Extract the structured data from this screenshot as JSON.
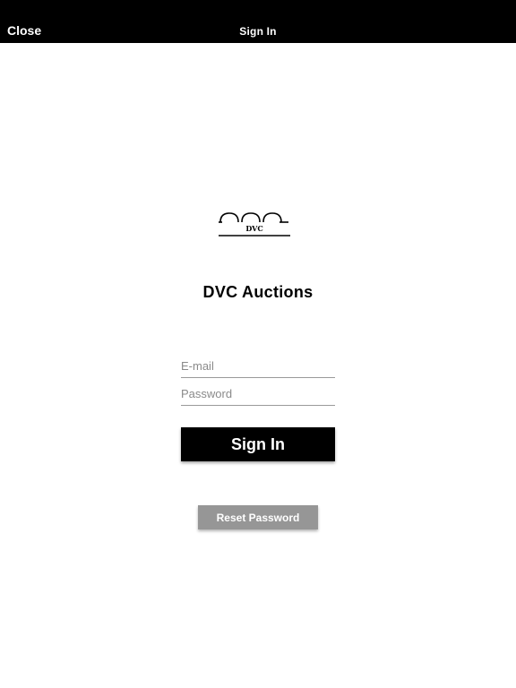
{
  "nav": {
    "close_label": "Close",
    "title": "Sign In"
  },
  "logo": {
    "text": "DVC",
    "icon": "arches-logo"
  },
  "app_title": "DVC Auctions",
  "form": {
    "email_placeholder": "E-mail",
    "password_placeholder": "Password",
    "signin_label": "Sign In",
    "reset_label": "Reset Password"
  },
  "colors": {
    "navbar": "#000000",
    "primary_button": "#000000",
    "secondary_button": "#969696"
  }
}
